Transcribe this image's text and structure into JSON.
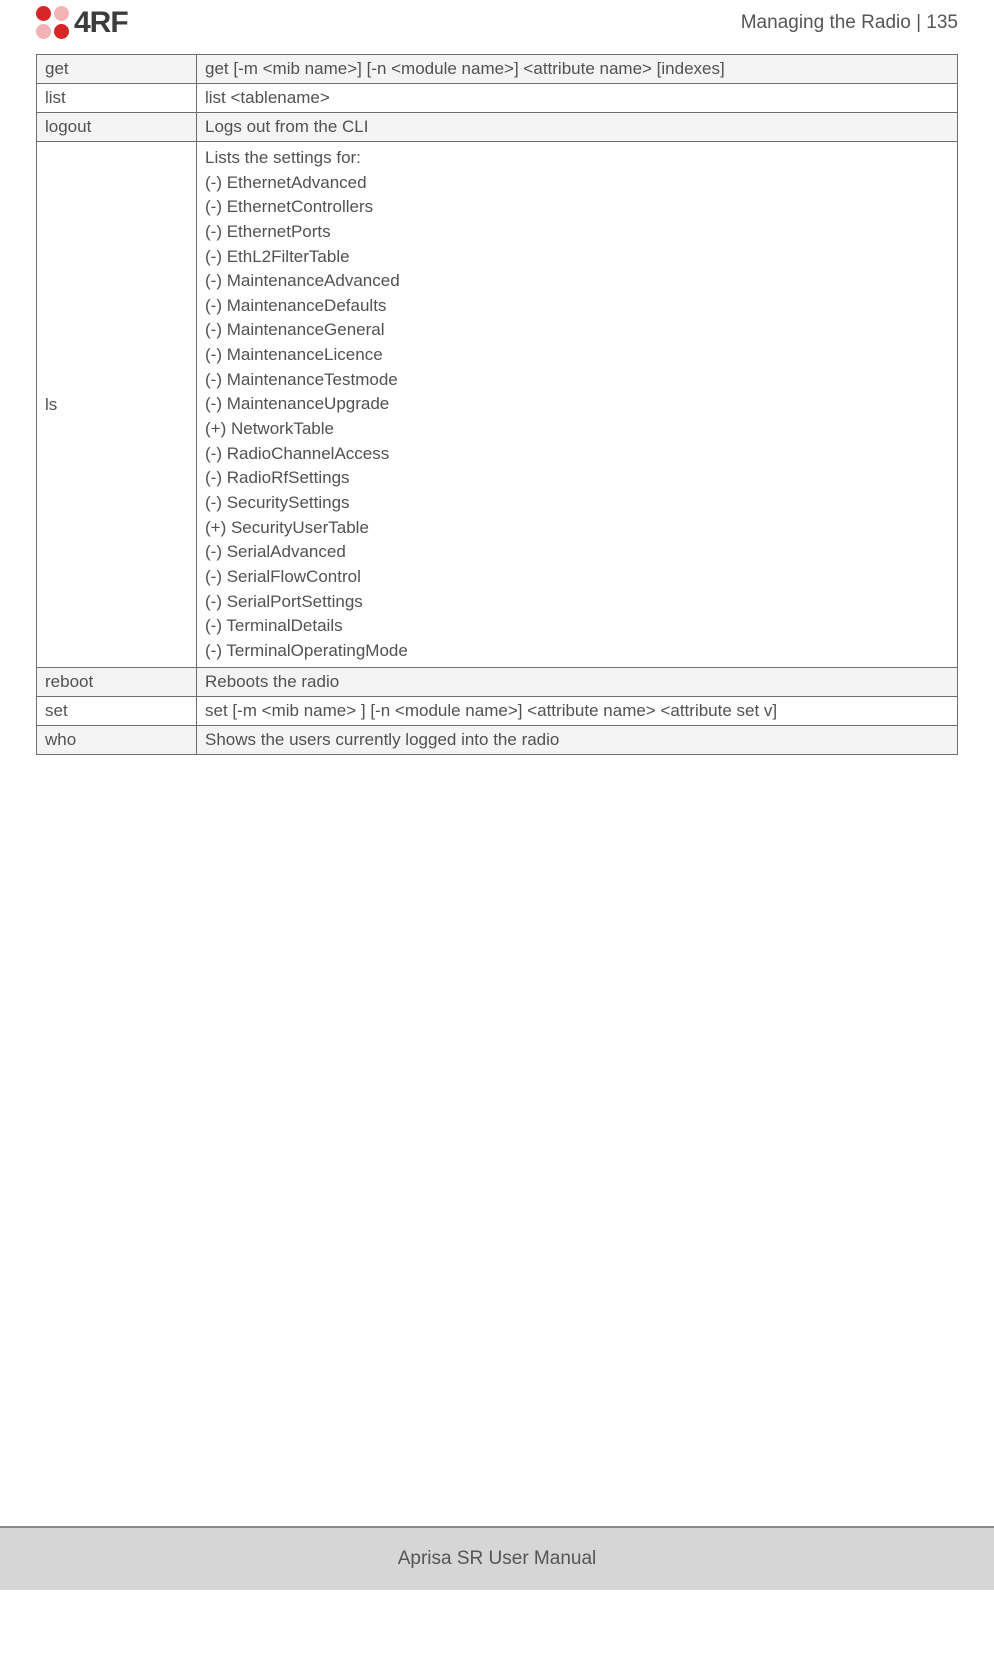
{
  "header": {
    "brand": "4RF",
    "title": "Managing the Radio  |  135"
  },
  "table": {
    "rows": [
      {
        "cmd": "get",
        "desc": "get [-m <mib name>] [-n <module name>] <attribute name> [indexes]",
        "shade": true
      },
      {
        "cmd": "list",
        "desc": "list <tablename>",
        "shade": false
      },
      {
        "cmd": "logout",
        "desc": "Logs out from the CLI",
        "shade": true
      },
      {
        "cmd": "ls",
        "desc_lines": [
          "Lists the settings for:",
          "(-) EthernetAdvanced",
          "(-) EthernetControllers",
          "(-) EthernetPorts",
          "(-) EthL2FilterTable",
          "(-) MaintenanceAdvanced",
          "(-) MaintenanceDefaults",
          "(-) MaintenanceGeneral",
          "(-) MaintenanceLicence",
          "(-) MaintenanceTestmode",
          "(-) MaintenanceUpgrade",
          "(+) NetworkTable",
          "(-) RadioChannelAccess",
          "(-) RadioRfSettings",
          "(-) SecuritySettings",
          "(+) SecurityUserTable",
          "(-) SerialAdvanced",
          "(-) SerialFlowControl",
          "(-) SerialPortSettings",
          "(-) TerminalDetails",
          "(-) TerminalOperatingMode"
        ],
        "shade": false
      },
      {
        "cmd": "reboot",
        "desc": "Reboots the radio",
        "shade": true
      },
      {
        "cmd": "set",
        "desc": "set [-m <mib name> ] [-n <module name>] <attribute name> <attribute set v]",
        "shade": false
      },
      {
        "cmd": "who",
        "desc": "Shows the users currently logged into the radio",
        "shade": true
      }
    ]
  },
  "footer": {
    "text": "Aprisa SR User Manual"
  }
}
